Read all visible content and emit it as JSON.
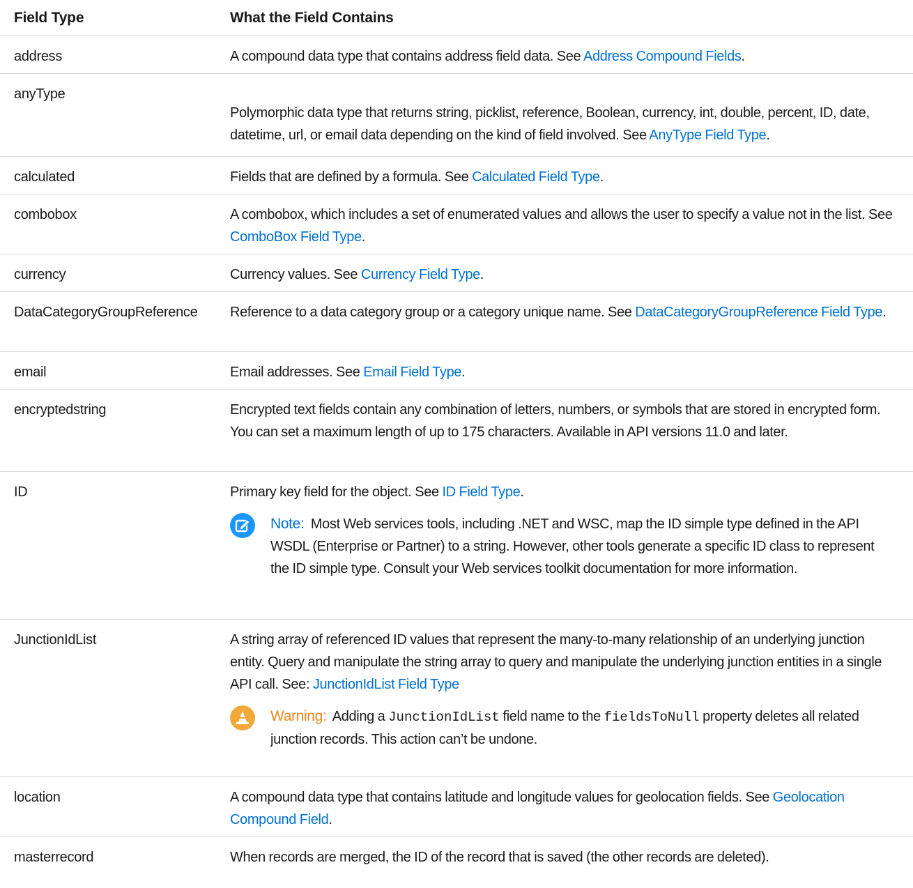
{
  "table": {
    "headers": {
      "field_type": "Field Type",
      "contains": "What the Field Contains"
    },
    "rows": [
      {
        "type": "address",
        "text_before": "A compound data type that contains address field data. See ",
        "link": "Address Compound Fields",
        "text_after": "."
      },
      {
        "type": "anyType",
        "text_before": "Polymorphic data type that returns string, picklist, reference, Boolean, currency, int, double, percent, ID, date, datetime, url, or email data depending on the kind of field involved. See ",
        "link": "AnyType Field Type",
        "text_after": "."
      },
      {
        "type": "calculated",
        "text_before": "Fields that are defined by a formula. See ",
        "link": "Calculated Field Type",
        "text_after": "."
      },
      {
        "type": "combobox",
        "text_before": "A combobox, which includes a set of enumerated values and allows the user to specify a value not in the list. See ",
        "link": "ComboBox Field Type",
        "text_after": "."
      },
      {
        "type": "currency",
        "text_before": "Currency values. See ",
        "link": "Currency Field Type",
        "text_after": "."
      },
      {
        "type": "DataCategoryGroupReference",
        "text_before": "Reference to a data category group or a category unique name. See ",
        "link": "DataCategoryGroupReference Field Type",
        "text_after": "."
      },
      {
        "type": "email",
        "text_before": "Email addresses. See ",
        "link": "Email Field Type",
        "text_after": "."
      },
      {
        "type": "encryptedstring",
        "text": "Encrypted text fields contain any combination of letters, numbers, or symbols that are stored in encrypted form. You can set a maximum length of up to 175 characters. Available in API versions 11.0 and later."
      },
      {
        "type": "ID",
        "text_before": "Primary key field for the object. See ",
        "link": "ID Field Type",
        "text_after": ".",
        "note": {
          "label": "Note:",
          "text": "Most Web services tools, including .NET and WSC, map the ID simple type defined in the API WSDL (Enterprise or Partner) to a string. However, other tools generate a specific ID class to represent the ID simple type. Consult your Web services toolkit documentation for more information.",
          "icon": "edit-note-icon",
          "color": "#1b96ff"
        }
      },
      {
        "type": "JunctionIdList",
        "text_before": "A string array of referenced ID values that represent the many-to-many relationship of an underlying junction entity. Query and manipulate the string array to query and manipulate the underlying junction entities in a single API call. See: ",
        "link": "JunctionIdList Field Type",
        "text_after": "",
        "warning": {
          "label": "Warning:",
          "text_1": "Adding a ",
          "code_1": "JunctionIdList",
          "text_2": " field name to the ",
          "code_2": "fieldsToNull",
          "text_3": " property deletes all related junction records. This action can’t be undone.",
          "icon": "warning-cone-icon",
          "color": "#f2a93b"
        }
      },
      {
        "type": "location",
        "text_before": "A compound data type that contains latitude and longitude values for geolocation fields. See ",
        "link": "Geolocation Compound Field",
        "text_after": "."
      },
      {
        "type": "masterrecord",
        "text": "When records are merged, the ID of the record that is saved (the other records are deleted)."
      }
    ]
  },
  "colors": {
    "link": "#0070d2",
    "note_label": "#0070d2",
    "warning_label": "#e8851a",
    "rule": "#d8d8d8"
  }
}
